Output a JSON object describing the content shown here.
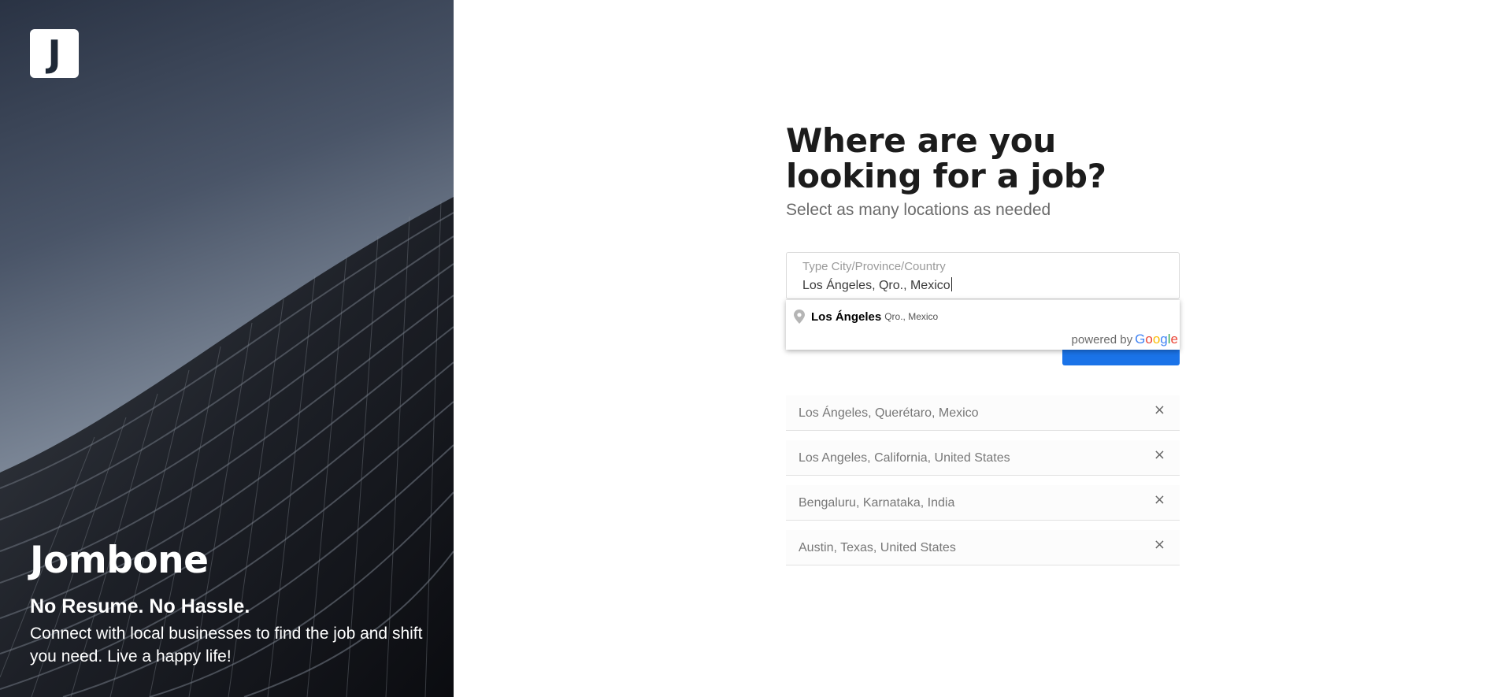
{
  "hero": {
    "logo_letter": "J",
    "brand": "Jombone",
    "tagline": "No Resume. No Hassle.",
    "description": "Connect with local businesses to find the job and shift you need. Live a happy life!"
  },
  "form": {
    "title": "Where are you looking for a job?",
    "subtitle": "Select as many locations as needed",
    "search": {
      "label": "Type City/Province/Country",
      "value": "Los Ángeles, Qro., Mexico"
    },
    "add_button_label": "",
    "autocomplete": {
      "main_text": "Los Ángeles",
      "secondary_text": "Qro., Mexico",
      "powered_by": "powered by",
      "google_letters": [
        "G",
        "o",
        "o",
        "g",
        "l",
        "e"
      ]
    },
    "selected_locations": [
      {
        "label": "Los Ángeles, Querétaro, Mexico",
        "remove": "×"
      },
      {
        "label": "Los Angeles, California, United States",
        "remove": "×"
      },
      {
        "label": "Bengaluru, Karnataka, India",
        "remove": "×"
      },
      {
        "label": "Austin, Texas, United States",
        "remove": "×"
      }
    ]
  },
  "colors": {
    "primary_button": "#1a73e8",
    "heading_text": "#1c1c1c",
    "muted_text": "#6b6b6b"
  }
}
